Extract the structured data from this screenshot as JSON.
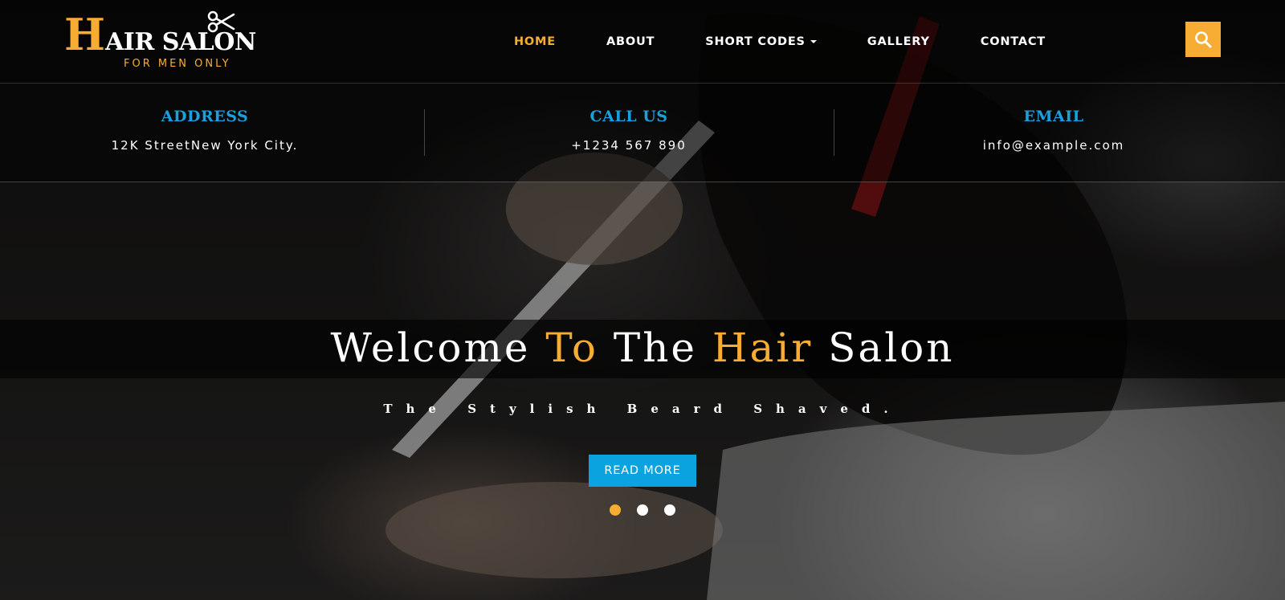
{
  "brand": {
    "logo_initial": "H",
    "logo_rest": "AIR SALON",
    "tagline": "FOR MEN ONLY",
    "accent_color": "#f7ad33"
  },
  "nav": {
    "items": [
      {
        "label": "HOME",
        "active": true
      },
      {
        "label": "ABOUT",
        "active": false
      },
      {
        "label": "SHORT CODES",
        "active": false,
        "has_dropdown": true
      },
      {
        "label": "GALLERY",
        "active": false
      },
      {
        "label": "CONTACT",
        "active": false
      }
    ],
    "search_icon": "search-icon"
  },
  "info": [
    {
      "title": "ADDRESS",
      "value": "12K StreetNew York City."
    },
    {
      "title": "CALL US",
      "value": "+1234 567 890"
    },
    {
      "title": "EMAIL",
      "value": "info@example.com"
    }
  ],
  "info_title_color": "#1aa0de",
  "hero": {
    "title_parts": [
      "Welcome ",
      "To",
      " The ",
      "Hair",
      " Salon"
    ],
    "subtitle": "The Stylish Beard Shaved.",
    "button_label": "READ MORE",
    "button_color": "#0aa2df",
    "slides": 3,
    "active_slide": 1
  }
}
